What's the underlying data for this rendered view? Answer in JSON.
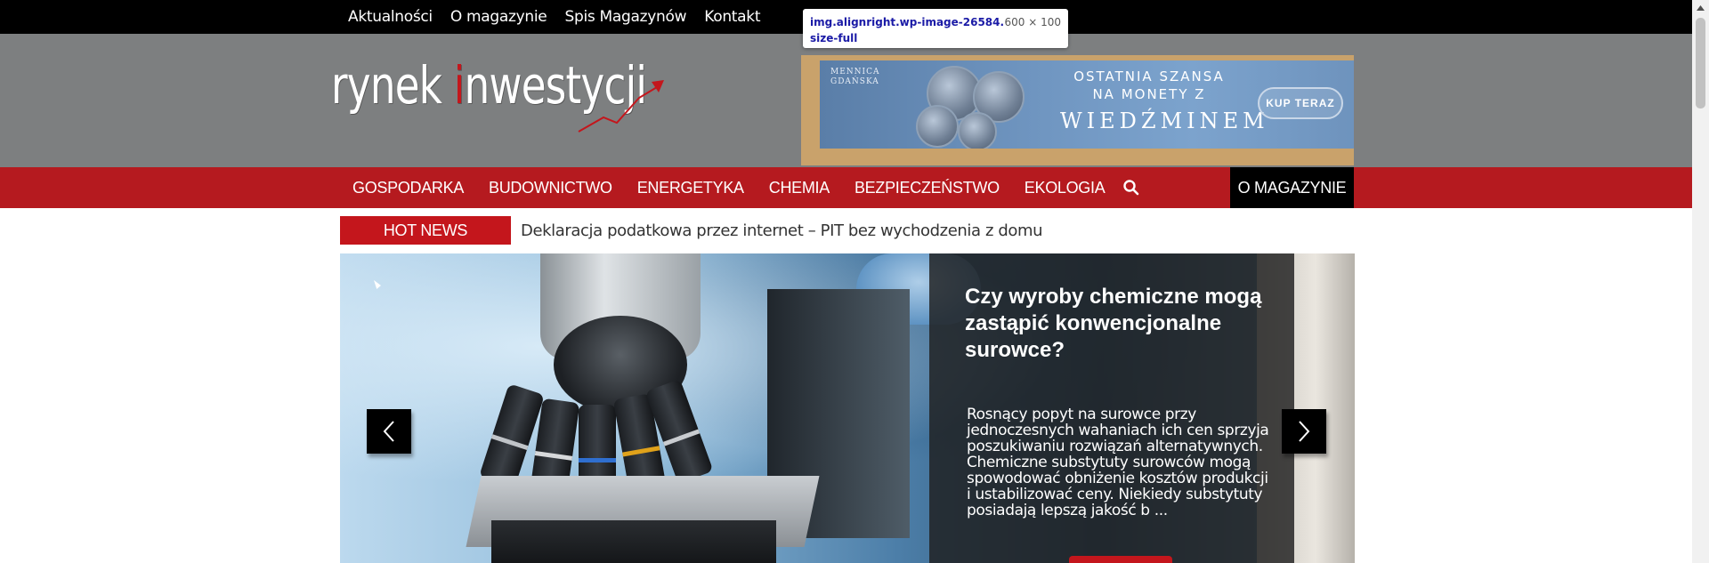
{
  "topnav": {
    "items": [
      "Aktualności",
      "O magazynie",
      "Spis Magazynów",
      "Kontakt"
    ]
  },
  "logo": {
    "part1": "rynek ",
    "part2_red": "i",
    "part2": "nwestycji"
  },
  "devtools_tooltip": {
    "selector": "img.alignright.wp-image-26584.size-full",
    "dimensions": "600 × 100"
  },
  "ad": {
    "mint": "MENNICA\nGDAŃSKA",
    "line1": "OSTATNIA SZANSA NA MONETY Z",
    "line2": "WIEDŹMINEM",
    "button": "KUP TERAZ"
  },
  "categories": [
    "GOSPODARKA",
    "BUDOWNICTWO",
    "ENERGETYKA",
    "CHEMIA",
    "BEZPIECZEŃSTWO",
    "EKOLOGIA"
  ],
  "magazine_button": "O MAGAZYNIE",
  "hot_news": {
    "label": "HOT NEWS",
    "headline": "Deklaracja podatkowa przez internet – PIT bez wychodzenia z domu"
  },
  "slide": {
    "title": "Czy wyroby chemiczne mogą zastąpić konwencjonalne surowce?",
    "excerpt": "Rosnący popyt na surowce przy jednoczesnych wahaniach ich cen sprzyja poszukiwaniu rozwiązań alternatywnych. Chemiczne substytuty surowców mogą spowodować obniżenie kosztów produkcji i ustabilizować ceny. Niekiedy substytuty posiadają lepszą jakość b ..."
  },
  "colors": {
    "brand_red": "#b51a1f",
    "header_gray": "#7d7f80",
    "topbar": "#000000"
  },
  "icons": {
    "search": "search-icon",
    "prev": "chevron-left-icon",
    "next": "chevron-right-icon"
  }
}
